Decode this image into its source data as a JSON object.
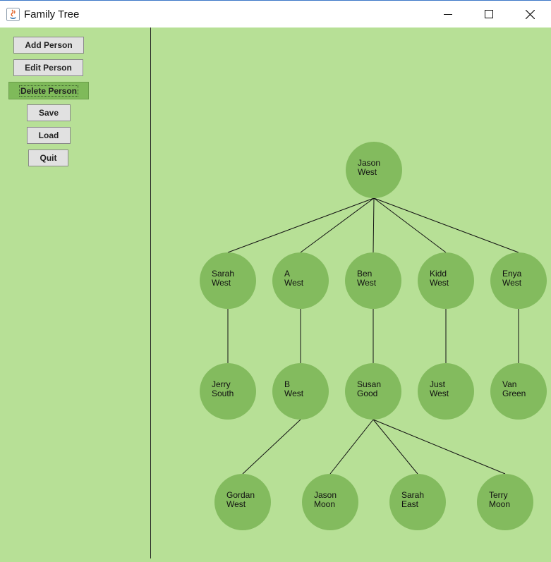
{
  "window": {
    "title": "Family Tree",
    "controls": [
      "minimize",
      "maximize",
      "close"
    ]
  },
  "sidebar": {
    "buttons": [
      {
        "label": "Add Person",
        "state": "default"
      },
      {
        "label": "Edit Person",
        "state": "default"
      },
      {
        "label": "Delete Person",
        "state": "focused"
      },
      {
        "label": "Save",
        "state": "default"
      },
      {
        "label": "Load",
        "state": "default"
      },
      {
        "label": "Quit",
        "state": "default"
      }
    ]
  },
  "tree": {
    "colors": {
      "node": "#83bb5e",
      "background": "#b7e096",
      "edge": "#111111"
    },
    "nodes": [
      {
        "id": "jason_west",
        "line1": "Jason",
        "line2": "West"
      },
      {
        "id": "sarah_west",
        "line1": "Sarah",
        "line2": "West"
      },
      {
        "id": "a_west",
        "line1": "A",
        "line2": "West"
      },
      {
        "id": "ben_west",
        "line1": "Ben",
        "line2": "West"
      },
      {
        "id": "kidd_west",
        "line1": "Kidd",
        "line2": "West"
      },
      {
        "id": "enya_west",
        "line1": "Enya",
        "line2": "West"
      },
      {
        "id": "jerry_south",
        "line1": "Jerry",
        "line2": "South"
      },
      {
        "id": "b_west",
        "line1": "B",
        "line2": "West"
      },
      {
        "id": "susan_good",
        "line1": "Susan",
        "line2": "Good"
      },
      {
        "id": "just_west",
        "line1": "Just",
        "line2": "West"
      },
      {
        "id": "van_green",
        "line1": "Van",
        "line2": "Green"
      },
      {
        "id": "gordan_west",
        "line1": "Gordan",
        "line2": "West"
      },
      {
        "id": "jason_moon",
        "line1": "Jason",
        "line2": "Moon"
      },
      {
        "id": "sarah_east",
        "line1": "Sarah",
        "line2": "East"
      },
      {
        "id": "terry_moon",
        "line1": "Terry",
        "line2": "Moon"
      }
    ],
    "edges": [
      [
        "jason_west",
        "sarah_west"
      ],
      [
        "jason_west",
        "a_west"
      ],
      [
        "jason_west",
        "ben_west"
      ],
      [
        "jason_west",
        "kidd_west"
      ],
      [
        "jason_west",
        "enya_west"
      ],
      [
        "sarah_west",
        "jerry_south"
      ],
      [
        "a_west",
        "b_west"
      ],
      [
        "ben_west",
        "susan_good"
      ],
      [
        "kidd_west",
        "just_west"
      ],
      [
        "enya_west",
        "van_green"
      ],
      [
        "b_west",
        "gordan_west"
      ],
      [
        "susan_good",
        "jason_moon"
      ],
      [
        "susan_good",
        "sarah_east"
      ],
      [
        "susan_good",
        "terry_moon"
      ]
    ]
  }
}
